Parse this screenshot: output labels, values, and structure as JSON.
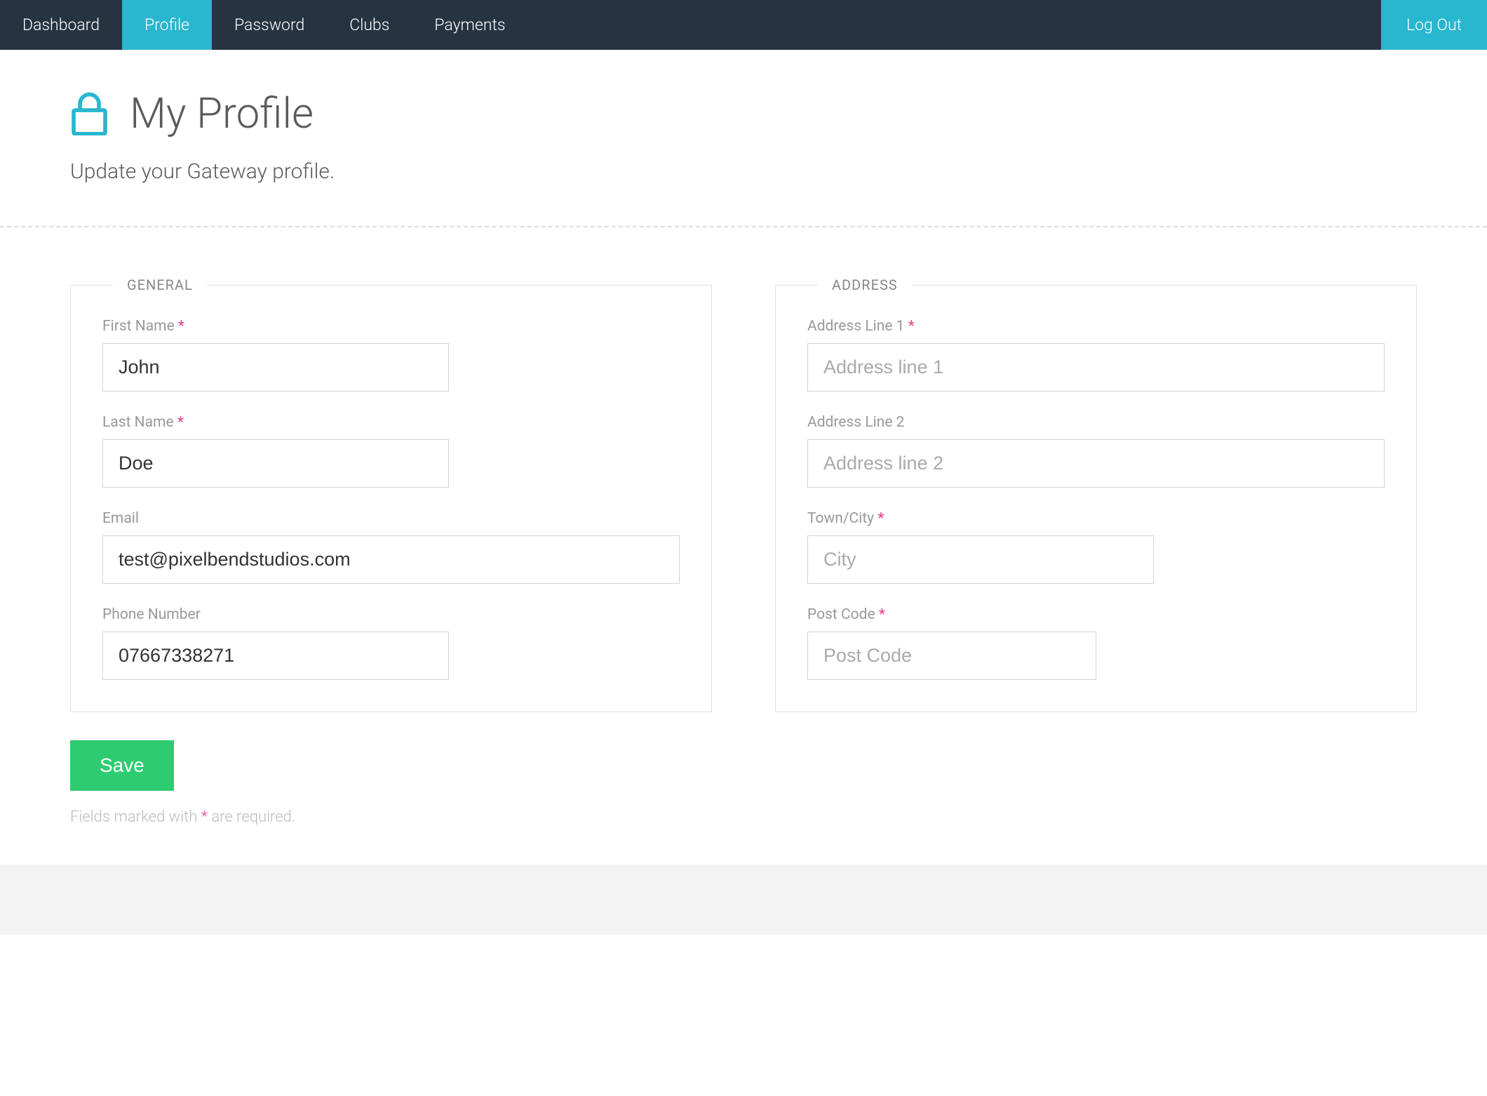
{
  "nav": {
    "items": [
      {
        "label": "Dashboard",
        "active": false
      },
      {
        "label": "Profile",
        "active": true
      },
      {
        "label": "Password",
        "active": false
      },
      {
        "label": "Clubs",
        "active": false
      },
      {
        "label": "Payments",
        "active": false
      }
    ],
    "logout": "Log Out"
  },
  "header": {
    "title": "My Profile",
    "subtitle": "Update your Gateway profile."
  },
  "sections": {
    "general": {
      "legend": "GENERAL",
      "fields": {
        "first_name": {
          "label": "First Name",
          "required": true,
          "value": "John",
          "placeholder": ""
        },
        "last_name": {
          "label": "Last Name",
          "required": true,
          "value": "Doe",
          "placeholder": ""
        },
        "email": {
          "label": "Email",
          "required": false,
          "value": "test@pixelbendstudios.com",
          "placeholder": ""
        },
        "phone": {
          "label": "Phone Number",
          "required": false,
          "value": "07667338271",
          "placeholder": ""
        }
      }
    },
    "address": {
      "legend": "ADDRESS",
      "fields": {
        "line1": {
          "label": "Address Line 1",
          "required": true,
          "value": "",
          "placeholder": "Address line 1"
        },
        "line2": {
          "label": "Address Line 2",
          "required": false,
          "value": "",
          "placeholder": "Address line 2"
        },
        "city": {
          "label": "Town/City",
          "required": true,
          "value": "",
          "placeholder": "City"
        },
        "postcode": {
          "label": "Post Code",
          "required": true,
          "value": "",
          "placeholder": "Post Code"
        }
      }
    }
  },
  "actions": {
    "save": "Save"
  },
  "footnote": {
    "prefix": "Fields marked with ",
    "star": "*",
    "suffix": " are required."
  }
}
